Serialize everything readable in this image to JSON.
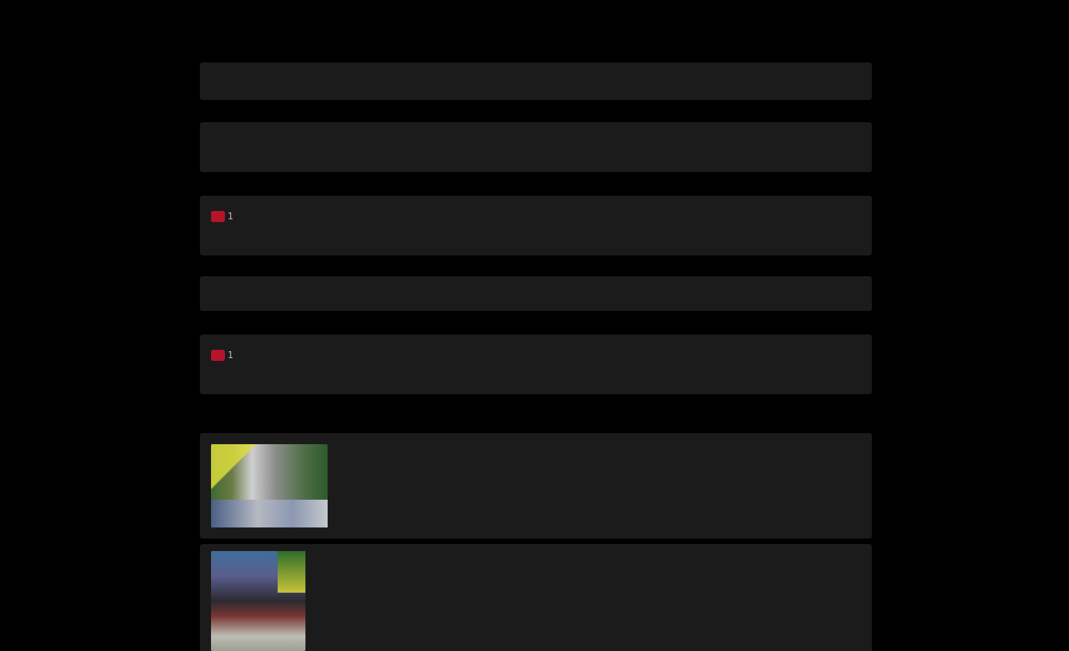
{
  "header": {
    "top_text": "",
    "left": "",
    "title": "",
    "subtitle": "",
    "right": ""
  },
  "messages": [
    {
      "author": "",
      "time": "",
      "text": "",
      "reaction": ""
    },
    {
      "author": "",
      "time": "",
      "text": "",
      "reaction": ""
    },
    {
      "author": "",
      "time": "",
      "text": "",
      "reaction": "1"
    },
    {
      "author": "",
      "time": "",
      "text": "",
      "reaction": ""
    },
    {
      "author": "",
      "time": "",
      "text": "",
      "reaction": "1"
    }
  ],
  "divider": "",
  "photo_post": {
    "author": "",
    "time": ""
  },
  "colors": {
    "background": "#000000",
    "bubble": "#1b1b1b",
    "reaction": "#b6142a"
  },
  "icons": {
    "reaction": "heart-icon"
  }
}
